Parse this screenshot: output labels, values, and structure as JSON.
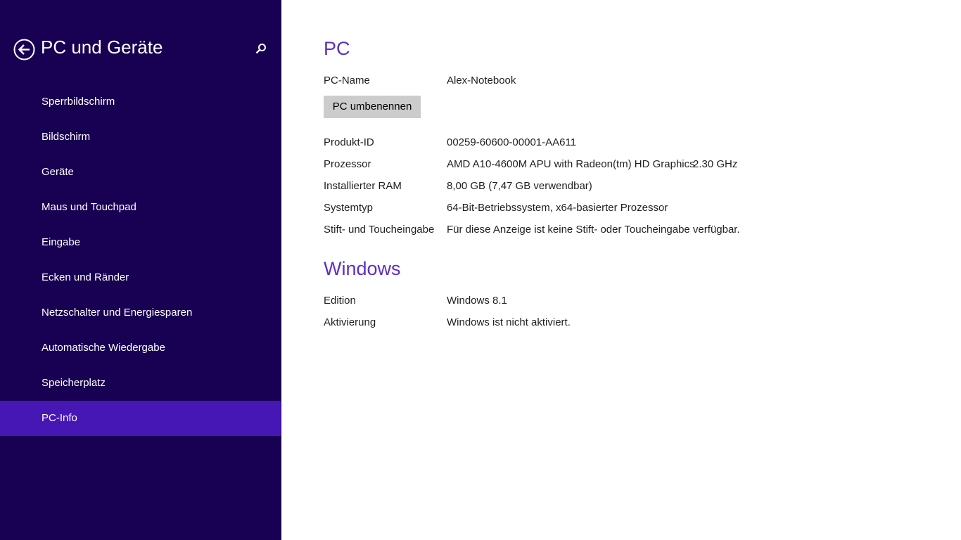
{
  "sidebar": {
    "title": "PC und Geräte",
    "back_icon": "back-arrow-circle-icon",
    "search_icon": "search-icon",
    "items": [
      {
        "label": "Sperrbildschirm"
      },
      {
        "label": "Bildschirm"
      },
      {
        "label": "Geräte"
      },
      {
        "label": "Maus und Touchpad"
      },
      {
        "label": "Eingabe"
      },
      {
        "label": "Ecken und Ränder"
      },
      {
        "label": "Netzschalter und Energiesparen"
      },
      {
        "label": "Automatische Wiedergabe"
      },
      {
        "label": "Speicherplatz"
      },
      {
        "label": "PC-Info",
        "selected": true
      }
    ]
  },
  "colors": {
    "sidebar_bg": "#180052",
    "selected_bg": "#4617b4",
    "accent": "#5d2fc2",
    "button_bg": "#cccccc"
  },
  "pc": {
    "title": "PC",
    "name_label": "PC-Name",
    "name_value": "Alex-Notebook",
    "rename_button": "PC umbenennen",
    "product_id_label": "Produkt-ID",
    "product_id_value": "00259-60600-00001-AA611",
    "processor_label": "Prozessor",
    "processor_value": "AMD A10-4600M APU with Radeon(tm) HD Graphics",
    "processor_speed": "2.30 GHz",
    "ram_label": "Installierter RAM",
    "ram_value": "8,00 GB (7,47 GB verwendbar)",
    "systemtype_label": "Systemtyp",
    "systemtype_value": "64-Bit-Betriebssystem, x64-basierter Prozessor",
    "pen_label": "Stift- und Toucheingabe",
    "pen_value": "Für diese Anzeige ist keine Stift- oder Toucheingabe verfügbar."
  },
  "windows": {
    "title": "Windows",
    "edition_label": "Edition",
    "edition_value": "Windows 8.1",
    "activation_label": "Aktivierung",
    "activation_value": "Windows ist nicht aktiviert."
  }
}
